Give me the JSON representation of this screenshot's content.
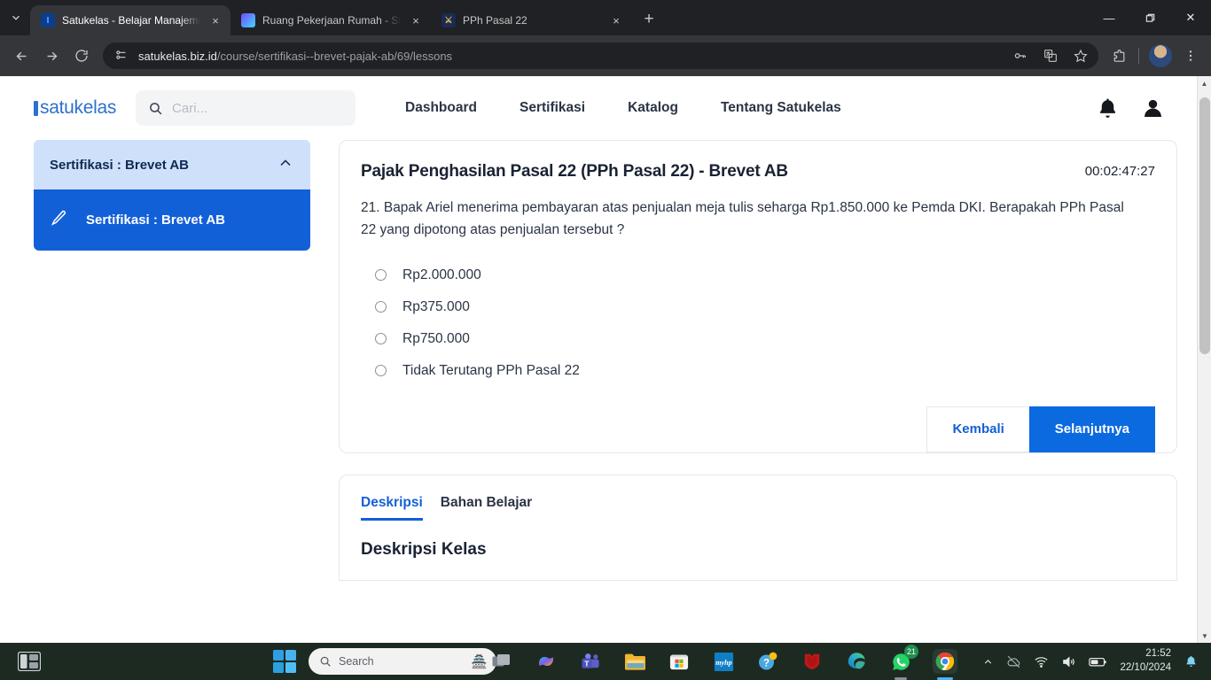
{
  "browser": {
    "tabs": [
      {
        "title": "Satukelas - Belajar Manajemen",
        "favicon": "satukelas-icon",
        "active": true
      },
      {
        "title": "Ruang Pekerjaan Rumah - Study",
        "favicon": "study-icon",
        "active": false
      },
      {
        "title": "PPh Pasal 22",
        "favicon": "pph-icon",
        "active": false
      }
    ],
    "new_tab_label": "+",
    "tab_close_label": "×",
    "window_controls": {
      "minimize": "—",
      "maximize": "❐",
      "close": "✕"
    },
    "address": {
      "host": "satukelas.biz.id",
      "path": "/course/sertifikasi--brevet-pajak-ab/69/lessons"
    },
    "toolbar_icons": [
      "back-icon",
      "forward-icon",
      "reload-icon",
      "site-info-icon",
      "password-key-icon",
      "translate-icon",
      "bookmark-star-icon",
      "extensions-icon",
      "profile-avatar",
      "chrome-menu-icon"
    ]
  },
  "site": {
    "logo_text": "satukelas",
    "search": {
      "placeholder": "Cari...",
      "value": ""
    },
    "nav": [
      {
        "label": "Dashboard"
      },
      {
        "label": "Sertifikasi"
      },
      {
        "label": "Katalog"
      },
      {
        "label": "Tentang Satukelas"
      }
    ],
    "header_icons": [
      "notification-bell-icon",
      "user-account-icon"
    ]
  },
  "sidebar": {
    "accordion_title": "Sertifikasi : Brevet AB",
    "accordion_state": "expanded",
    "items": [
      {
        "label": "Sertifikasi : Brevet AB",
        "icon": "pencil-icon",
        "active": true
      }
    ]
  },
  "quiz": {
    "title": "Pajak Penghasilan Pasal 22 (PPh Pasal 22) - Brevet AB",
    "timer": "00:02:47:27",
    "question_number": "21.",
    "question": "21. Bapak Ariel menerima pembayaran atas penjualan meja tulis seharga Rp1.850.000 ke Pemda DKI. Berapakah PPh Pasal 22 yang dipotong atas penjualan tersebut ?",
    "options": [
      {
        "label": "Rp2.000.000",
        "selected": false
      },
      {
        "label": "Rp375.000",
        "selected": false
      },
      {
        "label": "Rp750.000",
        "selected": false
      },
      {
        "label": "Tidak Terutang PPh Pasal 22",
        "selected": false
      }
    ],
    "back_button": "Kembali",
    "next_button": "Selanjutnya"
  },
  "lesson_tabs": {
    "items": [
      {
        "label": "Deskripsi",
        "active": true
      },
      {
        "label": "Bahan Belajar",
        "active": false
      }
    ],
    "section_heading": "Deskripsi Kelas"
  },
  "taskbar": {
    "start_label": "start-icon",
    "search_placeholder": "Search",
    "apps": [
      {
        "name": "task-view-icon"
      },
      {
        "name": "copilot-icon"
      },
      {
        "name": "teams-icon"
      },
      {
        "name": "file-explorer-icon"
      },
      {
        "name": "microsoft-store-icon"
      },
      {
        "name": "myhp-icon",
        "label": "myhp"
      },
      {
        "name": "help-icon"
      },
      {
        "name": "mcafee-icon"
      },
      {
        "name": "edge-icon"
      },
      {
        "name": "whatsapp-icon",
        "badge": "21"
      },
      {
        "name": "chrome-icon"
      }
    ],
    "tray_icons": [
      "chevron-up-icon",
      "onedrive-icon",
      "wifi-icon",
      "volume-icon",
      "battery-icon",
      "notification-bell-icon"
    ],
    "clock_time": "21:52",
    "clock_date": "22/10/2024"
  },
  "colors": {
    "brand_blue": "#1260d8",
    "accent_blue": "#0c6ae0",
    "sidebar_head": "#cfe0fb",
    "text_dark": "#1a2233"
  }
}
